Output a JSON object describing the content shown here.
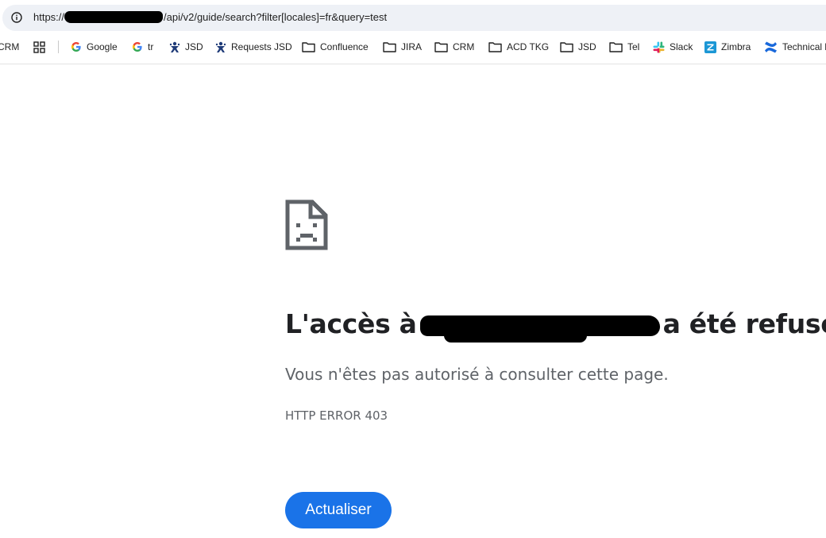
{
  "address_bar": {
    "url_prefix": "https://",
    "url_suffix": "/api/v2/guide/search?filter[locales]=fr&query=test"
  },
  "bookmarks": [
    {
      "label": "CRM",
      "icon": "none"
    },
    {
      "label": "",
      "icon": "apps-grid-icon"
    },
    {
      "label": "Google",
      "icon": "google-icon"
    },
    {
      "label": "tr",
      "icon": "google-icon"
    },
    {
      "label": "JSD",
      "icon": "jira-sd-icon"
    },
    {
      "label": "Requests JSD",
      "icon": "jira-sd-icon"
    },
    {
      "label": "Confluence",
      "icon": "folder-icon"
    },
    {
      "label": "JIRA",
      "icon": "folder-icon"
    },
    {
      "label": "CRM",
      "icon": "folder-icon"
    },
    {
      "label": "ACD TKG",
      "icon": "folder-icon"
    },
    {
      "label": "JSD",
      "icon": "folder-icon"
    },
    {
      "label": "Tel",
      "icon": "folder-icon"
    },
    {
      "label": "Slack",
      "icon": "slack-icon"
    },
    {
      "label": "Zimbra",
      "icon": "zimbra-icon"
    },
    {
      "label": "Technical b",
      "icon": "confluence-icon"
    }
  ],
  "error": {
    "title_before": "L'accès à",
    "title_after": "a été refusé",
    "message": "Vous n'êtes pas autorisé à consulter cette page.",
    "code": "HTTP ERROR 403",
    "button_label": "Actualiser"
  },
  "colors": {
    "accent": "#1a73e8",
    "omnibox_bg": "#eef1f6",
    "headline": "#202124",
    "secondary_text": "#5f6368"
  }
}
